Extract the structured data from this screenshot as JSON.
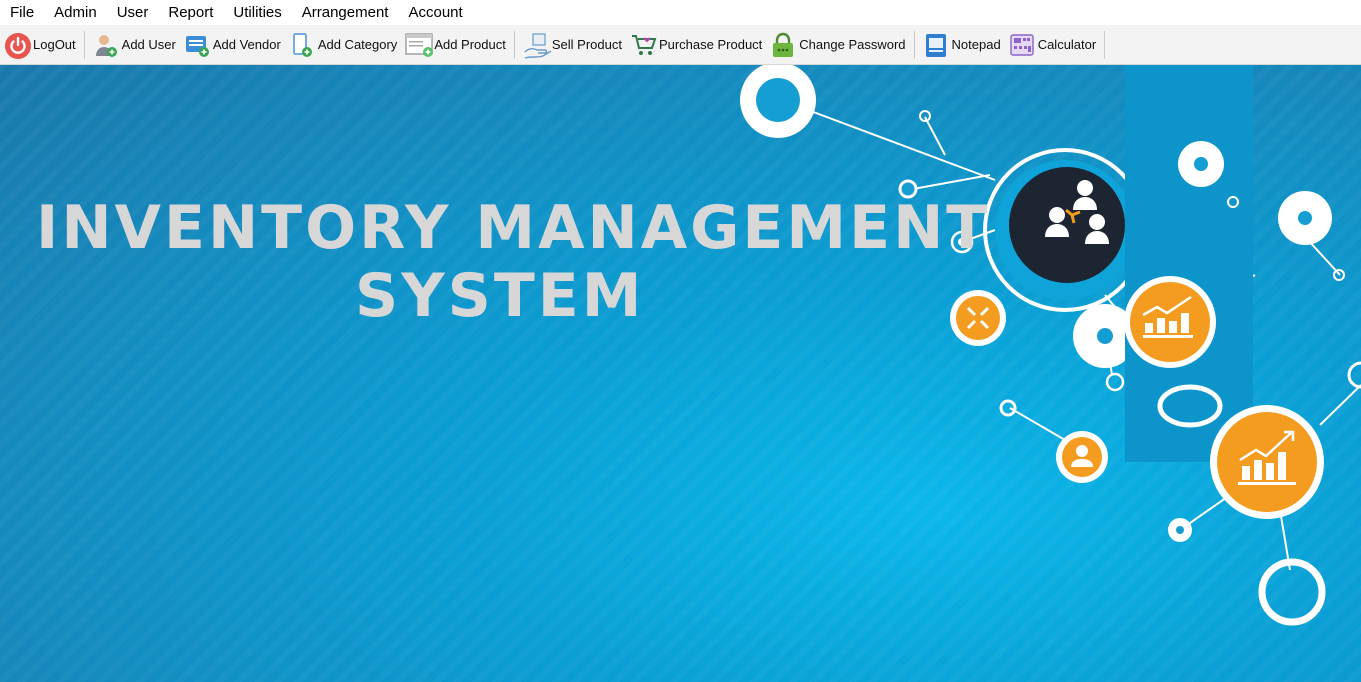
{
  "menu": [
    "File",
    "Admin",
    "User",
    "Report",
    "Utilities",
    "Arrangement",
    "Account"
  ],
  "toolbar": {
    "logout": "LogOut",
    "add_user": "Add User",
    "add_vendor": "Add Vendor",
    "add_category": "Add Category",
    "add_product": "Add Product",
    "sell_product": "Sell Product",
    "purchase_product": "Purchase Product",
    "change_password": "Change Password",
    "notepad": "Notepad",
    "calculator": "Calculator"
  },
  "hero": {
    "title_line1": "INVENTORY MANAGEMENT",
    "title_line2": "SYSTEM"
  },
  "colors": {
    "background": "#0a9fd4",
    "accent_orange": "#f39c1f",
    "title": "#d7d7d7"
  }
}
